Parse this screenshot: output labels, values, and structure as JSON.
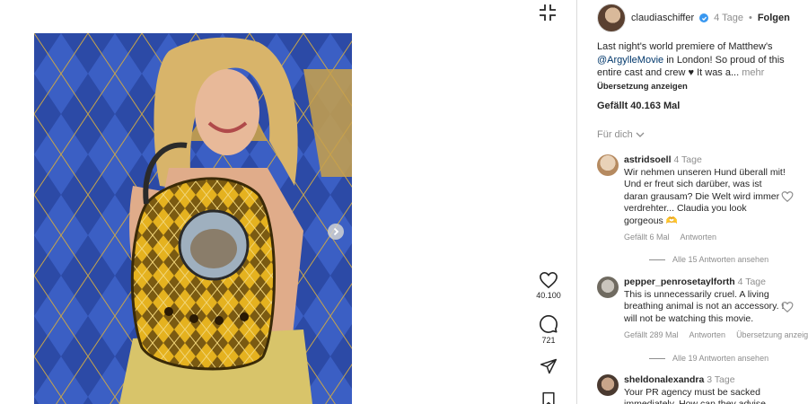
{
  "post": {
    "username": "claudiaschiffer",
    "time": "4 Tage",
    "separator": "•",
    "follow_label": "Folgen",
    "caption_text_1": "Last night's world premiere of Matthew's",
    "caption_mention": "@ArgylleMovie",
    "caption_text_2": " in London! So proud of this entire cast and crew ♥ It was a...",
    "more_label": "mehr",
    "translate_label": "Übersetzung anzeigen",
    "likes_label": "Gefällt 40.163 Mal",
    "for_you_label": "Für dich"
  },
  "actions": {
    "like_count": "40.100",
    "comment_count": "721"
  },
  "comments": [
    {
      "username": "astridsoell",
      "time": "4 Tage",
      "text": "Wir nehmen unseren Hund überall mit! Und er freut sich darüber, was ist daran grausam? Die Welt wird immer verdrehter... Claudia you look gorgeous 🫶",
      "likes": "Gefällt 6 Mal",
      "reply_label": "Antworten",
      "view_replies": "Alle 15 Antworten ansehen"
    },
    {
      "username": "pepper_penrosetaylforth",
      "time": "4 Tage",
      "text": "This is unnecessarily cruel. A living breathing animal is not an accessory. I will not be watching this movie.",
      "likes": "Gefällt 289 Mal",
      "reply_label": "Antworten",
      "translate_label": "Übersetzung anzeig",
      "view_replies": "Alle 19 Antworten ansehen"
    },
    {
      "username": "sheldonalexandra",
      "time": "3 Tage",
      "text": "Your PR agency must be sacked immediately. How can they advise"
    }
  ],
  "colors": {
    "verified": "#3897f0",
    "mention": "#00376b",
    "muted": "#8e8e8e",
    "divider": "#dbdbdb"
  },
  "icons": [
    "collapse-icon",
    "chevron-right-icon",
    "heart-icon",
    "comment-icon",
    "share-icon",
    "bookmark-icon",
    "chevron-down-icon",
    "verified-icon"
  ]
}
